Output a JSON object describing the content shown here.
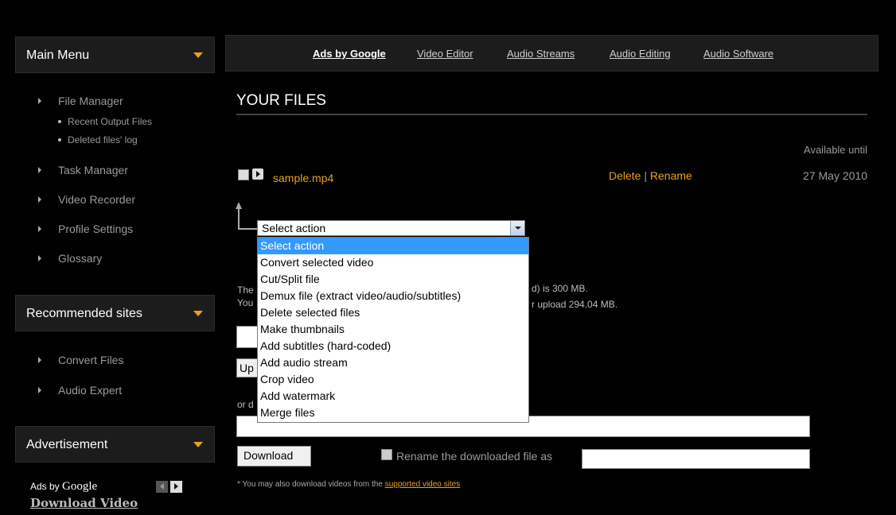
{
  "sidebar": {
    "main_menu": "Main Menu",
    "items": [
      {
        "label": "File Manager"
      },
      {
        "label": "Task Manager"
      },
      {
        "label": "Video Recorder"
      },
      {
        "label": "Profile Settings"
      },
      {
        "label": "Glossary"
      }
    ],
    "sub_items": [
      "Recent Output Files",
      "Deleted files' log"
    ],
    "recommended": "Recommended sites",
    "rec_items": [
      "Convert Files",
      "Audio Expert"
    ],
    "advertisement": "Advertisement",
    "ads_by": "Ads by",
    "google": "Google",
    "download_video": "Download Video"
  },
  "topnav": {
    "ads": "Ads by Google",
    "links": [
      "Video Editor",
      "Audio Streams",
      "Audio Editing",
      "Audio Software"
    ]
  },
  "main": {
    "title": "YOUR FILES",
    "available_until": "Available until",
    "file": {
      "name": "sample.mp4",
      "delete": "Delete",
      "sep": "|",
      "rename": "Rename",
      "date": "27 May 2010"
    },
    "select": {
      "value": "Select action",
      "options": [
        "Select action",
        "Convert selected video",
        "Cut/Split file",
        "Demux file (extract video/audio/subtitles)",
        "Delete selected files",
        "Make thumbnails",
        "Add subtitles (hard-coded)",
        "Add audio stream",
        "Crop video",
        "Add watermark",
        "Merge files"
      ]
    },
    "info_line1_start": "The",
    "info_line1_end": "d) is 300 MB.",
    "info_line2_start": "You",
    "info_line2_end": "r upload 294.04 MB.",
    "upload_btn": "Up",
    "or_text": "or d",
    "download_btn": "Download",
    "rename_label": "Rename the downloaded file as",
    "footnote_star": "*",
    "footnote": "You may also download videos from the",
    "footnote_link": "supported video sites"
  },
  "colors": {
    "accent": "#e8a21a",
    "panel": "#1c1c1c",
    "highlight": "#3399ff"
  }
}
